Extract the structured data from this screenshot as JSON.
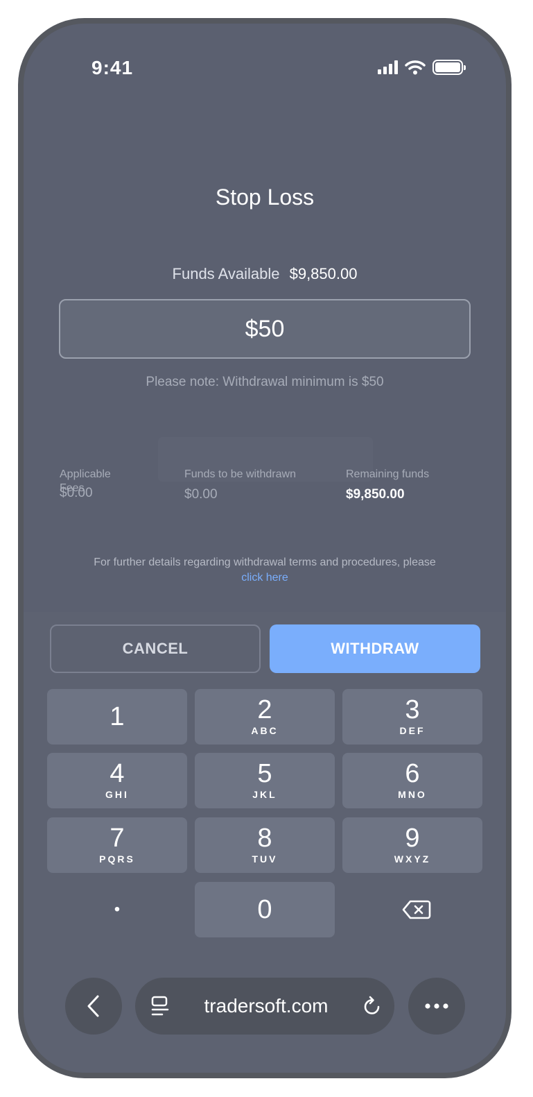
{
  "status_bar": {
    "time": "9:41"
  },
  "dialog": {
    "title": "Stop Loss",
    "funds_available_label": "Funds Available",
    "funds_available_value": "$9,850.00",
    "amount_value": "$50",
    "note": "Please note: Withdrawal minimum is $50"
  },
  "summary": {
    "fees_label": "Applicable Fees",
    "fees_value": "$0.00",
    "withdrawn_label": "Funds to be withdrawn",
    "withdrawn_value": "$0.00",
    "remaining_label": "Remaining funds",
    "remaining_value": "$9,850.00"
  },
  "terms": {
    "text": "For further details regarding withdrawal terms and procedures, please",
    "link": "click here"
  },
  "actions": {
    "cancel_label": "CANCEL",
    "withdraw_label": "WITHDRAW",
    "withdraw_color": "#7aaefc"
  },
  "keypad": {
    "keys": [
      {
        "num": "1",
        "letters": ""
      },
      {
        "num": "2",
        "letters": "ABC"
      },
      {
        "num": "3",
        "letters": "DEF"
      },
      {
        "num": "4",
        "letters": "GHI"
      },
      {
        "num": "5",
        "letters": "JKL"
      },
      {
        "num": "6",
        "letters": "MNO"
      },
      {
        "num": "7",
        "letters": "PQRS"
      },
      {
        "num": "8",
        "letters": "TUV"
      },
      {
        "num": "9",
        "letters": "WXYZ"
      },
      {
        "num": "0",
        "letters": ""
      }
    ],
    "decimal": "•",
    "backspace_icon": "backspace-icon"
  },
  "browser": {
    "url": "tradersoft.com"
  }
}
